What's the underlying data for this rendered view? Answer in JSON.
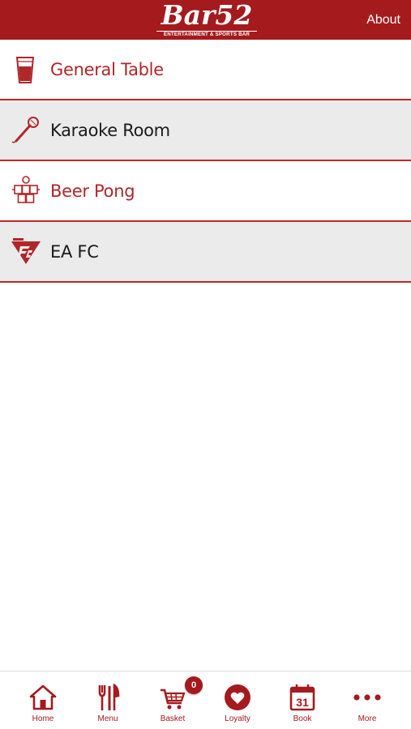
{
  "header": {
    "logo_main": "Bar52",
    "logo_sub": "ENTERTAINMENT & SPORTS BAR",
    "about_label": "About"
  },
  "colors": {
    "brand_red": "#a51a1d",
    "row_alt_bg": "#ebebeb"
  },
  "list": {
    "items": [
      {
        "label": "General Table",
        "icon": "drink-cup-icon"
      },
      {
        "label": "Karaoke Room",
        "icon": "microphone-icon"
      },
      {
        "label": "Beer Pong",
        "icon": "beer-pong-icon"
      },
      {
        "label": "EA FC",
        "icon": "ea-fc-logo-icon"
      }
    ]
  },
  "tabbar": {
    "tabs": [
      {
        "label": "Home",
        "icon": "home-icon"
      },
      {
        "label": "Menu",
        "icon": "cutlery-icon"
      },
      {
        "label": "Basket",
        "icon": "cart-icon"
      },
      {
        "label": "Loyalty",
        "icon": "heart-icon"
      },
      {
        "label": "Book",
        "icon": "calendar-icon",
        "icon_text": "31"
      },
      {
        "label": "More",
        "icon": "more-dots-icon"
      }
    ],
    "basket_count": "0"
  }
}
